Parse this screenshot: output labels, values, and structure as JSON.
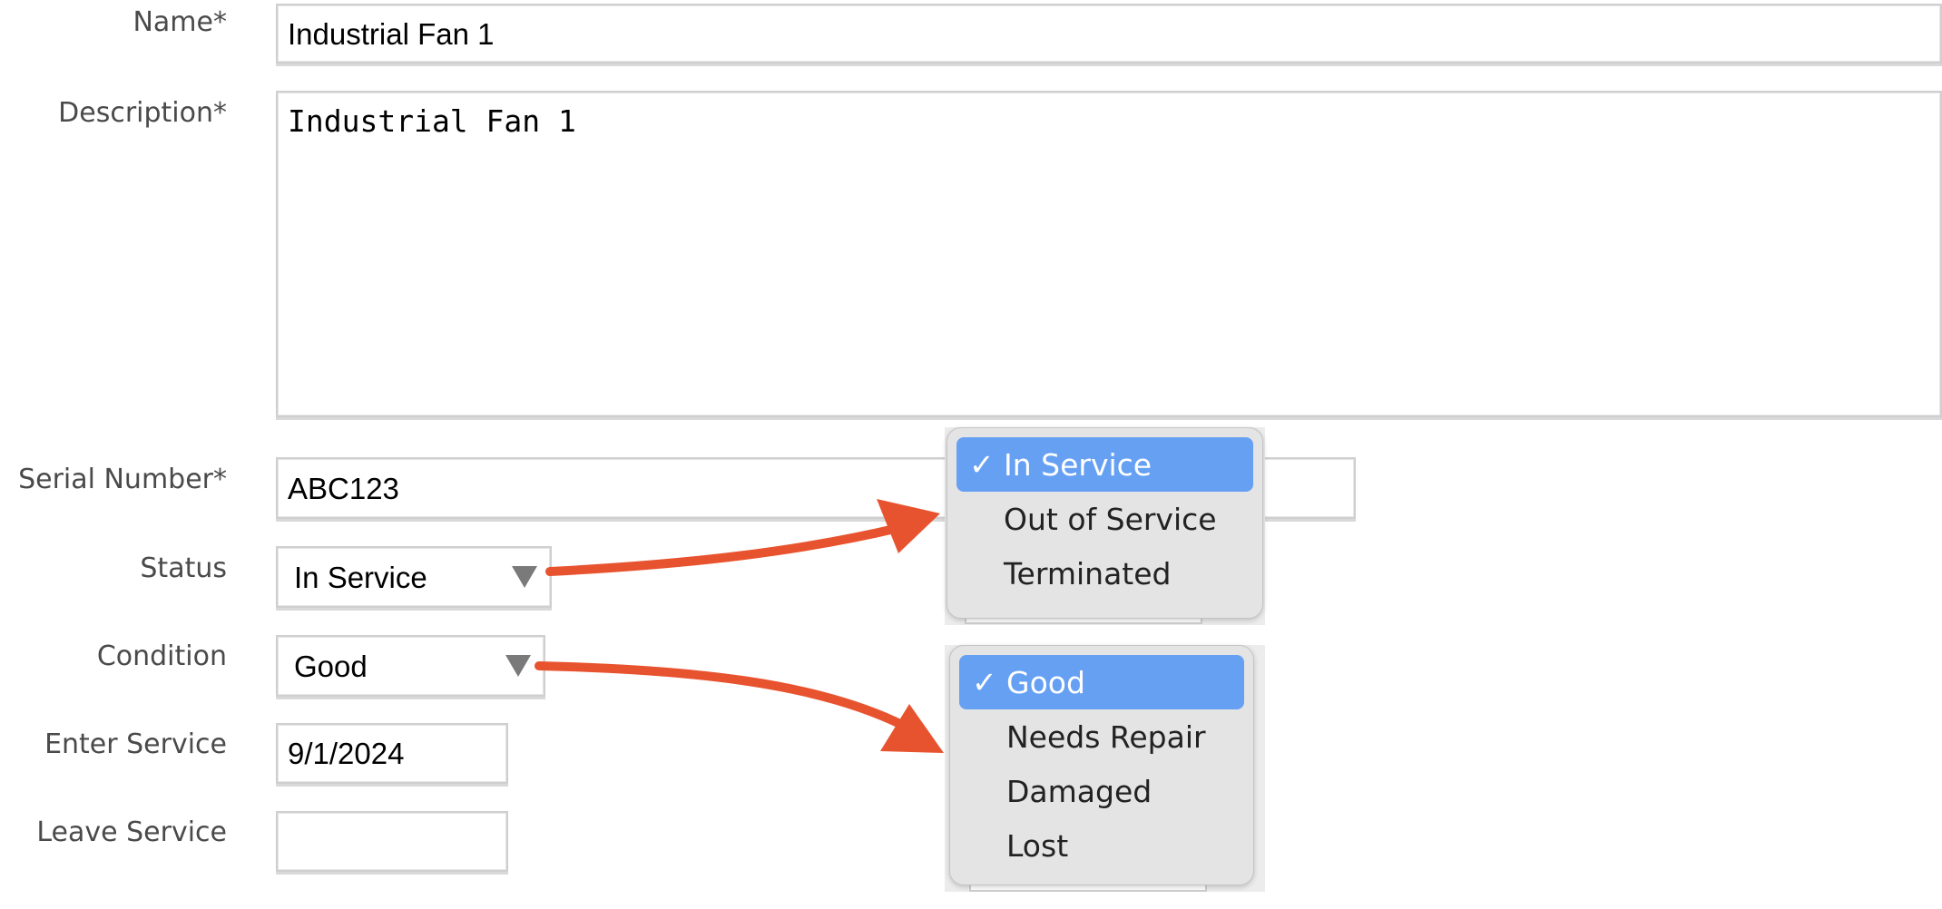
{
  "form": {
    "name": {
      "label": "Name*",
      "value": "Industrial Fan 1"
    },
    "description": {
      "label": "Description*",
      "value": "Industrial Fan 1"
    },
    "serial_number": {
      "label": "Serial Number*",
      "value": "ABC123"
    },
    "status": {
      "label": "Status",
      "value": "In Service"
    },
    "condition": {
      "label": "Condition",
      "value": "Good"
    },
    "enter_service": {
      "label": "Enter Service",
      "value": "9/1/2024"
    },
    "leave_service": {
      "label": "Leave Service",
      "value": ""
    }
  },
  "status_menu": {
    "check": "✓",
    "options": [
      "In Service",
      "Out of Service",
      "Terminated"
    ],
    "selected": "In Service"
  },
  "condition_menu": {
    "check": "✓",
    "options": [
      "Good",
      "Needs Repair",
      "Damaged",
      "Lost"
    ],
    "selected": "Good"
  },
  "colors": {
    "annotation_arrow": "#e8532f",
    "menu_highlight": "#66a0f3"
  },
  "icons": {
    "select_arrow": "chevron-down-icon",
    "checkmark": "checkmark-icon",
    "callout_arrow": "arrow-icon"
  }
}
